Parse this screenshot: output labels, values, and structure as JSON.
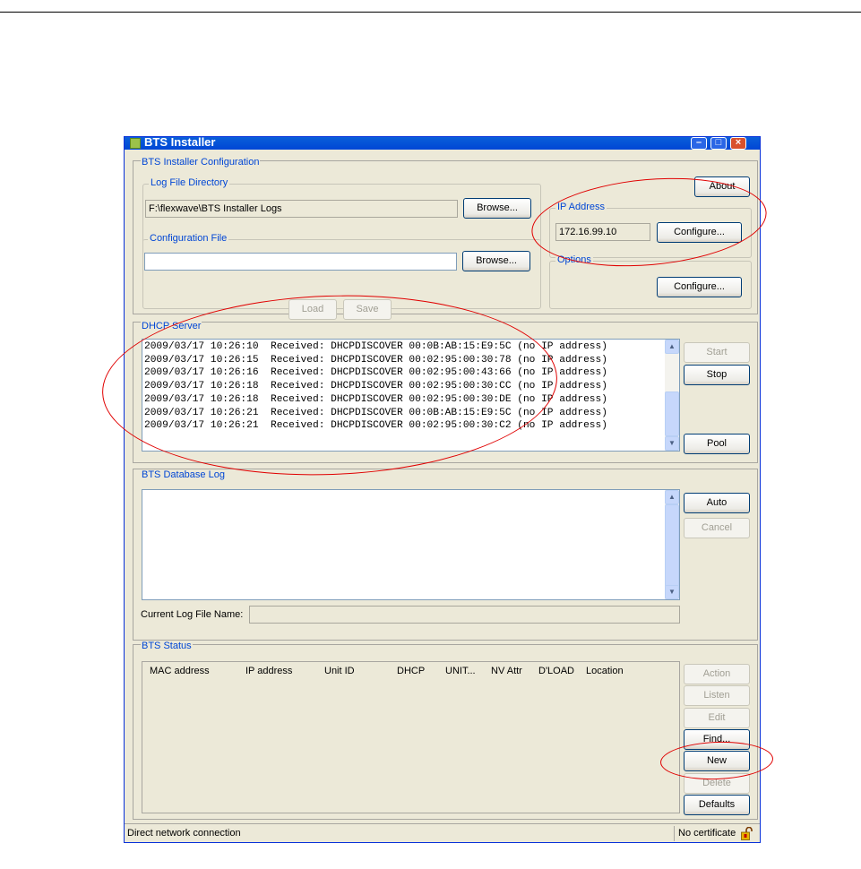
{
  "window": {
    "title": "BTS Installer",
    "accent_color": "#0046d5",
    "annotation_color": "#e00000"
  },
  "config": {
    "panel_title": "BTS Installer Configuration",
    "log_dir_title": "Log File Directory",
    "log_dir_value": "F:\\flexwave\\BTS Installer Logs",
    "browse_label": "Browse...",
    "config_file_title": "Configuration File",
    "config_file_value": "",
    "browse2_label": "Browse...",
    "load_label": "Load",
    "save_label": "Save",
    "about_label": "About",
    "ip_title": "IP Address",
    "ip_value": "172.16.99.10",
    "configure_label": "Configure...",
    "options_title": "Options",
    "configure2_label": "Configure..."
  },
  "dhcp": {
    "panel_title": "DHCP Server",
    "lines": [
      "2009/03/17 10:26:10  Received: DHCPDISCOVER 00:0B:AB:15:E9:5C (no IP address)",
      "2009/03/17 10:26:15  Received: DHCPDISCOVER 00:02:95:00:30:78 (no IP address)",
      "2009/03/17 10:26:16  Received: DHCPDISCOVER 00:02:95:00:43:66 (no IP address)",
      "2009/03/17 10:26:18  Received: DHCPDISCOVER 00:02:95:00:30:CC (no IP address)",
      "2009/03/17 10:26:18  Received: DHCPDISCOVER 00:02:95:00:30:DE (no IP address)",
      "2009/03/17 10:26:21  Received: DHCPDISCOVER 00:0B:AB:15:E9:5C (no IP address)",
      "2009/03/17 10:26:21  Received: DHCPDISCOVER 00:02:95:00:30:C2 (no IP address)"
    ],
    "start_label": "Start",
    "stop_label": "Stop",
    "pool_label": "Pool"
  },
  "dblog": {
    "panel_title": "BTS Database Log",
    "auto_label": "Auto",
    "cancel_label": "Cancel",
    "current_log_label": "Current Log File Name:",
    "current_log_value": ""
  },
  "status_panel": {
    "panel_title": "BTS Status",
    "columns": [
      "MAC address",
      "IP address",
      "Unit ID",
      "DHCP",
      "UNIT...",
      "NV Attr",
      "D'LOAD",
      "Location"
    ],
    "action_label": "Action",
    "listen_label": "Listen",
    "edit_label": "Edit",
    "find_label": "Find...",
    "new_label": "New",
    "delete_label": "Delete",
    "defaults_label": "Defaults"
  },
  "statusbar": {
    "connection": "Direct network connection",
    "certificate": "No certificate"
  }
}
